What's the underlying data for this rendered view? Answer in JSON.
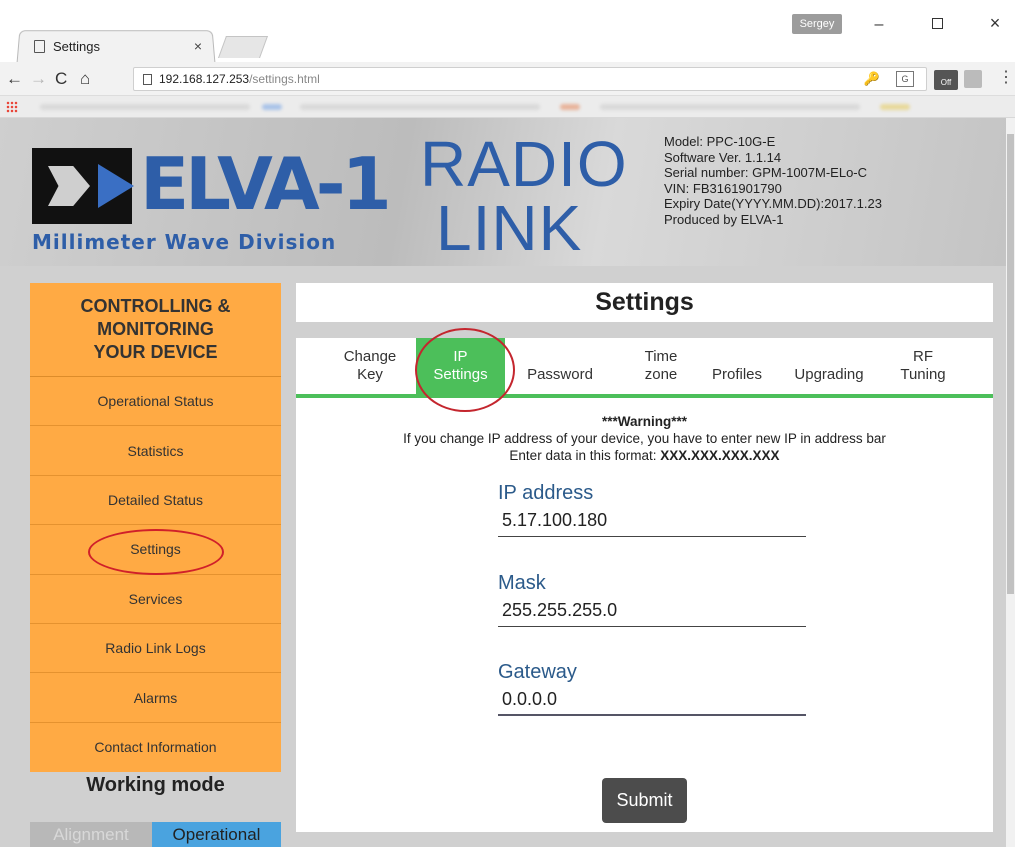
{
  "browser": {
    "tab_title": "Settings",
    "tab_close": "×",
    "profile_name": "Sergey",
    "window_minimize": "–",
    "window_close": "×",
    "nav_back": "←",
    "nav_forward": "→",
    "nav_reload": "C",
    "nav_home": "⌂",
    "url_host": "192.168.127.253",
    "url_path": "/settings.html",
    "menu": "⋮"
  },
  "banner": {
    "logo_word": "ELVA-1",
    "logo_subtitle": "Millimeter Wave Division",
    "radio_word": "RADIO",
    "link_word": "LINK",
    "device_info": [
      "Model: PPC-10G-E",
      "Software Ver. 1.1.14",
      "Serial number: GPM-1007M-ELo-C",
      "VIN: FB3161901790",
      "Expiry Date(YYYY.MM.DD):2017.1.23",
      "Produced by ELVA-1"
    ]
  },
  "sidebar": {
    "heading_line1": "CONTROLLING &",
    "heading_line2": "MONITORING",
    "heading_line3": "YOUR DEVICE",
    "items": [
      {
        "label": "Operational Status"
      },
      {
        "label": "Statistics"
      },
      {
        "label": "Detailed Status"
      },
      {
        "label": "Settings",
        "active": true
      },
      {
        "label": "Services"
      },
      {
        "label": "Radio Link Logs"
      },
      {
        "label": "Alarms"
      },
      {
        "label": "Contact Information"
      }
    ]
  },
  "working_mode": {
    "title": "Working mode",
    "options": [
      "Alignment",
      "Operational"
    ],
    "selected": "Operational"
  },
  "main": {
    "title": "Settings",
    "tabs": [
      {
        "line1": "Change",
        "line2": "Key"
      },
      {
        "line1": "IP",
        "line2": "Settings",
        "active": true
      },
      {
        "line1": "Password",
        "line2": ""
      },
      {
        "line1": "Time",
        "line2": "zone"
      },
      {
        "line1": "Profiles",
        "line2": ""
      },
      {
        "line1": "Upgrading",
        "line2": ""
      },
      {
        "line1": "RF",
        "line2": "Tuning"
      }
    ],
    "warning_title": "***Warning***",
    "warning_text": "If you change IP address of your device, you have to enter new IP in address bar",
    "format_prefix": "Enter data in this format: ",
    "format_value": "XXX.XXX.XXX.XXX",
    "fields": [
      {
        "label": "IP address",
        "value": "5.17.100.180"
      },
      {
        "label": "Mask",
        "value": "255.255.255.0"
      },
      {
        "label": "Gateway",
        "value": "0.0.0.0"
      }
    ],
    "submit_label": "Submit"
  },
  "colors": {
    "sidebar": "#ffaa44",
    "active_tab": "#4cbf5a",
    "brand_blue": "#2e5ea8",
    "highlight_circle": "#d0202a",
    "operational": "#4aa3df"
  }
}
